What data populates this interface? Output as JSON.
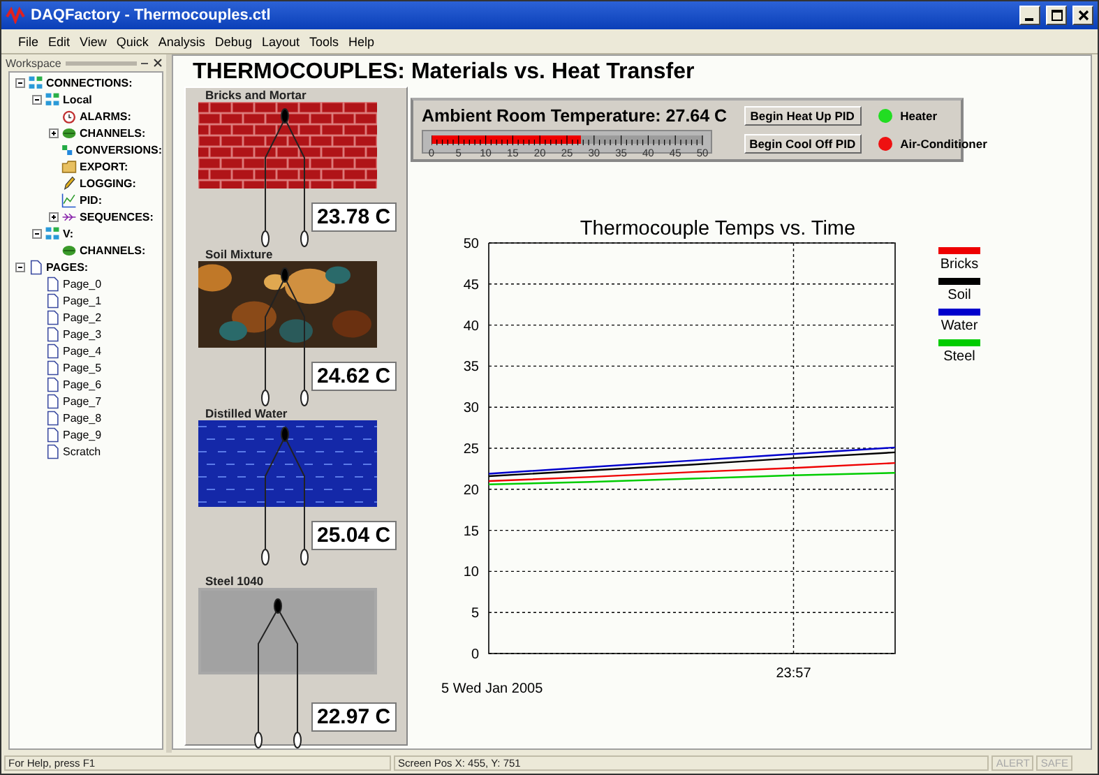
{
  "window": {
    "title": "DAQFactory - Thermocouples.ctl"
  },
  "menu": [
    "File",
    "Edit",
    "View",
    "Quick",
    "Analysis",
    "Debug",
    "Layout",
    "Tools",
    "Help"
  ],
  "workspace": {
    "title": "Workspace",
    "tree": [
      {
        "label": "CONNECTIONS:",
        "kind": "network",
        "expanded": true,
        "children": [
          {
            "label": "Local",
            "kind": "network",
            "expanded": true,
            "children": [
              {
                "label": "ALARMS:",
                "kind": "alarm"
              },
              {
                "label": "CHANNELS:",
                "kind": "leaf",
                "expanded": false
              },
              {
                "label": "CONVERSIONS:",
                "kind": "conversion"
              },
              {
                "label": "EXPORT:",
                "kind": "folder"
              },
              {
                "label": "LOGGING:",
                "kind": "pencil"
              },
              {
                "label": "PID:",
                "kind": "graph"
              },
              {
                "label": "SEQUENCES:",
                "kind": "arrows",
                "expanded": false
              }
            ]
          },
          {
            "label": "V:",
            "kind": "network",
            "expanded": true,
            "children": [
              {
                "label": "CHANNELS:",
                "kind": "leaf"
              }
            ]
          }
        ]
      },
      {
        "label": "PAGES:",
        "kind": "pages",
        "expanded": true,
        "children": [
          {
            "label": "Page_0",
            "kind": "page"
          },
          {
            "label": "Page_1",
            "kind": "page"
          },
          {
            "label": "Page_2",
            "kind": "page"
          },
          {
            "label": "Page_3",
            "kind": "page"
          },
          {
            "label": "Page_4",
            "kind": "page"
          },
          {
            "label": "Page_5",
            "kind": "page"
          },
          {
            "label": "Page_6",
            "kind": "page"
          },
          {
            "label": "Page_7",
            "kind": "page"
          },
          {
            "label": "Page_8",
            "kind": "page"
          },
          {
            "label": "Page_9",
            "kind": "page"
          },
          {
            "label": "Scratch",
            "kind": "page"
          }
        ]
      }
    ]
  },
  "page": {
    "title": "THERMOCOUPLES: Materials vs. Heat Transfer",
    "materials": [
      {
        "name": "Bricks and Mortar",
        "kind": "brick",
        "reading": "23.78 C"
      },
      {
        "name": "Soil Mixture",
        "kind": "soil",
        "reading": "24.62 C"
      },
      {
        "name": "Distilled Water",
        "kind": "water",
        "reading": "25.04 C"
      },
      {
        "name": "Steel 1040",
        "kind": "steel",
        "reading": "22.97 C"
      }
    ],
    "ambient": {
      "label": "Ambient Room Temperature: 27.64 C",
      "level": 0.553,
      "ticks": [
        "0",
        "5",
        "10",
        "15",
        "20",
        "25",
        "30",
        "35",
        "40",
        "45",
        "50"
      ]
    },
    "buttons": [
      "Begin Heat Up PID",
      "Begin Cool Off PID"
    ],
    "indicators": [
      {
        "label": "Heater",
        "color": "#22dd22"
      },
      {
        "label": "Air-Conditioner",
        "color": "#ee1111"
      }
    ],
    "chart": {
      "date_label": "5 Wed Jan 2005",
      "chart_data": {
        "type": "line",
        "title": "Thermocouple Temps vs. Time",
        "grid": true,
        "legend": "right",
        "ylim": [
          0,
          50
        ],
        "yticks": [
          0,
          5,
          10,
          15,
          20,
          25,
          30,
          35,
          40,
          45,
          50
        ],
        "annotations": [
          "23:57"
        ],
        "series": [
          {
            "name": "Bricks",
            "color": "#ee0000",
            "values": [
              21.0,
              21.5,
              22.1,
              22.6,
              23.2
            ]
          },
          {
            "name": "Soil",
            "color": "#000000",
            "values": [
              21.6,
              22.3,
              23.0,
              23.8,
              24.5
            ]
          },
          {
            "name": "Water",
            "color": "#0000cc",
            "values": [
              21.9,
              22.7,
              23.5,
              24.3,
              25.1
            ]
          },
          {
            "name": "Steel",
            "color": "#00cc00",
            "values": [
              20.6,
              20.9,
              21.3,
              21.7,
              22.0
            ]
          }
        ]
      }
    }
  },
  "status_bar": {
    "help": "For Help, press F1",
    "position": "Screen Pos X: 455, Y: 751",
    "flags": [
      {
        "label": "ALERT",
        "disabled": true
      },
      {
        "label": "SAFE",
        "disabled": true
      }
    ]
  }
}
